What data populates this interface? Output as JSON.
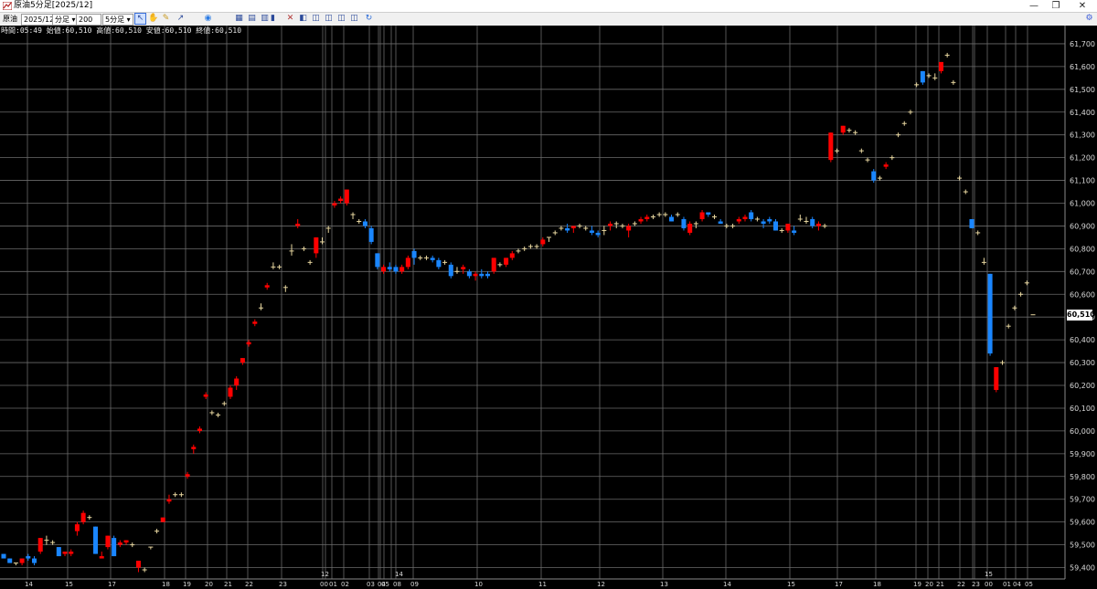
{
  "window": {
    "title": "原油5分足[2025/12]",
    "minimize_glyph": "—",
    "maximize_glyph": "❐",
    "close_glyph": "✕"
  },
  "toolbar": {
    "symbol_label": "原油",
    "contract_value": "2025/12",
    "period_unit_value": "分足",
    "bar_count_value": "200",
    "timeframe_value": "5分足",
    "tool_icons": [
      "cursor-icon",
      "hand-icon",
      "pencil-icon",
      "line-tool-icon",
      "globe-icon",
      "grid-icon",
      "table-icon",
      "grid-alt-icon",
      "bar-chart-icon",
      "candle-icon",
      "indicator-icon",
      "chart-window-icon",
      "chart-window-2-icon",
      "chart-window-3-icon",
      "chart-window-4-icon",
      "refresh-icon",
      "settings-icon"
    ]
  },
  "info_line": "時間:05:49 始値:60,510 高値:60,510 安値:60,510 終値:60,510",
  "colors": {
    "up": "#ff0000",
    "down": "#1a86ff",
    "doji": "#e8d7a0",
    "grid": "#6a6a6a",
    "axis_text": "#d9d9d9",
    "background": "#000000"
  },
  "chart_data": {
    "type": "candlestick",
    "ylim": [
      59350,
      61780
    ],
    "price_ticks": [
      59400,
      59500,
      59600,
      59700,
      59800,
      59900,
      60000,
      60100,
      60200,
      60300,
      60400,
      60500,
      60600,
      60700,
      60800,
      60900,
      61000,
      61100,
      61200,
      61300,
      61400,
      61500,
      61600,
      61700
    ],
    "price_tick_labels": [
      "59,400",
      "59,500",
      "59,600",
      "59,700",
      "59,800",
      "59,900",
      "60,000",
      "60,100",
      "60,200",
      "60,300",
      "60,400",
      "60,500",
      "60,600",
      "60,700",
      "60,800",
      "60,900",
      "61,000",
      "61,100",
      "61,200",
      "61,300",
      "61,400",
      "61,500",
      "61,600",
      "61,700"
    ],
    "last_price_label": "60,510",
    "last_price": 60510,
    "time_labels": [
      "14",
      "15",
      "17",
      "18",
      "19",
      "20",
      "21",
      "22",
      "23",
      "00",
      "01",
      "02",
      "03",
      "04",
      "05",
      "08",
      "09",
      "10",
      "11",
      "12",
      "13",
      "14",
      "15",
      "17",
      "18",
      "19",
      "20",
      "21",
      "22",
      "23",
      "00",
      "01",
      "04",
      "05"
    ],
    "date_labels": [
      "12",
      "14",
      "15"
    ],
    "candles": [
      [
        59460,
        59460,
        59440,
        59440
      ],
      [
        59440,
        59440,
        59420,
        59420
      ],
      [
        59420,
        59420,
        59410,
        59420
      ],
      [
        59420,
        59440,
        59410,
        59440
      ],
      [
        59450,
        59460,
        59430,
        59440
      ],
      [
        59440,
        59450,
        59410,
        59420
      ],
      [
        59470,
        59530,
        59460,
        59530
      ],
      [
        59520,
        59540,
        59500,
        59520
      ],
      [
        59510,
        59520,
        59500,
        59510
      ],
      [
        59490,
        59490,
        59450,
        59450
      ],
      [
        59460,
        59470,
        59450,
        59470
      ],
      [
        59460,
        59480,
        59450,
        59470
      ],
      [
        59560,
        59600,
        59540,
        59590
      ],
      [
        59600,
        59650,
        59590,
        59640
      ],
      [
        59620,
        59630,
        59610,
        59620
      ],
      [
        59580,
        59580,
        59460,
        59460
      ],
      [
        59440,
        59470,
        59440,
        59450
      ],
      [
        59490,
        59540,
        59480,
        59540
      ],
      [
        59530,
        59540,
        59450,
        59450
      ],
      [
        59500,
        59520,
        59490,
        59510
      ],
      [
        59510,
        59520,
        59500,
        59520
      ],
      [
        59500,
        59510,
        59490,
        59500
      ],
      [
        59400,
        59430,
        59380,
        59430
      ],
      [
        59390,
        59400,
        59380,
        59390
      ],
      [
        59490,
        59490,
        59480,
        59490
      ],
      [
        59560,
        59570,
        59550,
        59560
      ],
      [
        59600,
        59620,
        59600,
        59620
      ],
      [
        59690,
        59720,
        59680,
        59700
      ],
      [
        59720,
        59730,
        59710,
        59720
      ],
      [
        59720,
        59730,
        59710,
        59720
      ],
      [
        59800,
        59820,
        59790,
        59810
      ],
      [
        59920,
        59940,
        59900,
        59930
      ],
      [
        60000,
        60020,
        59990,
        60010
      ],
      [
        60150,
        60170,
        60140,
        60160
      ],
      [
        60080,
        60090,
        60070,
        60080
      ],
      [
        60070,
        60080,
        60060,
        60070
      ],
      [
        60120,
        60130,
        60110,
        60120
      ],
      [
        60150,
        60200,
        60140,
        60190
      ],
      [
        60200,
        60240,
        60180,
        60230
      ],
      [
        60300,
        60320,
        60290,
        60320
      ],
      [
        60380,
        60400,
        60370,
        60390
      ],
      [
        60470,
        60490,
        60460,
        60480
      ],
      [
        60540,
        60560,
        60530,
        60540
      ],
      [
        60630,
        60650,
        60620,
        60640
      ],
      [
        60720,
        60740,
        60710,
        60720
      ],
      [
        60720,
        60730,
        60710,
        60720
      ],
      [
        60630,
        60640,
        60610,
        60630
      ],
      [
        60790,
        60820,
        60770,
        60790
      ],
      [
        60900,
        60930,
        60890,
        60910
      ],
      [
        60800,
        60810,
        60790,
        60800
      ],
      [
        60740,
        60750,
        60730,
        60740
      ],
      [
        60780,
        60850,
        60760,
        60850
      ],
      [
        60830,
        60850,
        60820,
        60830
      ],
      [
        60890,
        60900,
        60870,
        60890
      ],
      [
        60990,
        61010,
        60980,
        61000
      ],
      [
        61010,
        61030,
        61000,
        61020
      ],
      [
        61000,
        61060,
        60990,
        61060
      ],
      [
        60950,
        60960,
        60930,
        60950
      ],
      [
        60920,
        60930,
        60910,
        60920
      ],
      [
        60920,
        60930,
        60890,
        60900
      ],
      [
        60890,
        60900,
        60820,
        60830
      ],
      [
        60780,
        60780,
        60710,
        60720
      ],
      [
        60700,
        60730,
        60690,
        60720
      ],
      [
        60720,
        60740,
        60700,
        60710
      ],
      [
        60720,
        60730,
        60690,
        60700
      ],
      [
        60700,
        60730,
        60690,
        60720
      ],
      [
        60720,
        60770,
        60710,
        60760
      ],
      [
        60790,
        60800,
        60730,
        60760
      ],
      [
        60760,
        60770,
        60750,
        60760
      ],
      [
        60760,
        60770,
        60750,
        60760
      ],
      [
        60760,
        60770,
        60740,
        60750
      ],
      [
        60750,
        60760,
        60710,
        60720
      ],
      [
        60740,
        60750,
        60730,
        60740
      ],
      [
        60730,
        60740,
        60670,
        60680
      ],
      [
        60700,
        60720,
        60690,
        60700
      ],
      [
        60710,
        60730,
        60690,
        60720
      ],
      [
        60700,
        60710,
        60670,
        60680
      ],
      [
        60680,
        60700,
        60660,
        60690
      ],
      [
        60690,
        60710,
        60670,
        60680
      ],
      [
        60690,
        60700,
        60670,
        60680
      ],
      [
        60700,
        60760,
        60690,
        60760
      ],
      [
        60730,
        60740,
        60720,
        60730
      ],
      [
        60730,
        60760,
        60720,
        60760
      ],
      [
        60760,
        60790,
        60750,
        60780
      ],
      [
        60790,
        60800,
        60780,
        60790
      ],
      [
        60800,
        60810,
        60790,
        60800
      ],
      [
        60810,
        60820,
        60800,
        60810
      ],
      [
        60810,
        60820,
        60800,
        60810
      ],
      [
        60820,
        60850,
        60810,
        60840
      ],
      [
        60850,
        60850,
        60830,
        60850
      ],
      [
        60870,
        60880,
        60860,
        60870
      ],
      [
        60890,
        60900,
        60880,
        60890
      ],
      [
        60890,
        60910,
        60870,
        60880
      ],
      [
        60890,
        60900,
        60870,
        60900
      ],
      [
        60900,
        60910,
        60890,
        60900
      ],
      [
        60890,
        60900,
        60880,
        60890
      ],
      [
        60880,
        60900,
        60860,
        60870
      ],
      [
        60870,
        60880,
        60850,
        60860
      ],
      [
        60880,
        60900,
        60860,
        60880
      ],
      [
        60900,
        60920,
        60880,
        60910
      ],
      [
        60910,
        60920,
        60890,
        60910
      ],
      [
        60900,
        60910,
        60890,
        60900
      ],
      [
        60880,
        60910,
        60850,
        60900
      ],
      [
        60910,
        60920,
        60900,
        60910
      ],
      [
        60920,
        60940,
        60910,
        60930
      ],
      [
        60930,
        60950,
        60920,
        60940
      ],
      [
        60940,
        60950,
        60930,
        60940
      ],
      [
        60950,
        60960,
        60940,
        60950
      ],
      [
        60950,
        60960,
        60940,
        60950
      ],
      [
        60940,
        60950,
        60920,
        60920
      ],
      [
        60950,
        60960,
        60940,
        60950
      ],
      [
        60930,
        60940,
        60880,
        60890
      ],
      [
        60870,
        60920,
        60860,
        60910
      ],
      [
        60910,
        60920,
        60890,
        60910
      ],
      [
        60930,
        60970,
        60920,
        60960
      ],
      [
        60960,
        60960,
        60940,
        60950
      ],
      [
        60940,
        60950,
        60930,
        60940
      ],
      [
        60920,
        60930,
        60910,
        60910
      ],
      [
        60900,
        60910,
        60890,
        60900
      ],
      [
        60900,
        60910,
        60890,
        60900
      ],
      [
        60920,
        60940,
        60910,
        60930
      ],
      [
        60930,
        60950,
        60920,
        60940
      ],
      [
        60960,
        60970,
        60920,
        60930
      ],
      [
        60930,
        60940,
        60920,
        60930
      ],
      [
        60920,
        60930,
        60890,
        60910
      ],
      [
        60930,
        60940,
        60910,
        60920
      ],
      [
        60920,
        60930,
        60880,
        60880
      ],
      [
        60880,
        60890,
        60870,
        60880
      ],
      [
        60880,
        60910,
        60870,
        60910
      ],
      [
        60880,
        60900,
        60860,
        60870
      ],
      [
        60930,
        60950,
        60920,
        60930
      ],
      [
        60920,
        60940,
        60910,
        60920
      ],
      [
        60930,
        60940,
        60890,
        60900
      ],
      [
        60900,
        60920,
        60880,
        60910
      ],
      [
        60900,
        60910,
        60890,
        60900
      ],
      [
        61190,
        61310,
        61180,
        61310
      ],
      [
        61230,
        61240,
        61220,
        61230
      ],
      [
        61310,
        61340,
        61300,
        61340
      ],
      [
        61320,
        61330,
        61310,
        61320
      ],
      [
        61310,
        61320,
        61300,
        61310
      ],
      [
        61230,
        61240,
        61220,
        61230
      ],
      [
        61190,
        61200,
        61180,
        61190
      ],
      [
        61140,
        61150,
        61090,
        61100
      ],
      [
        61110,
        61120,
        61100,
        61110
      ],
      [
        61160,
        61180,
        61150,
        61170
      ],
      [
        61200,
        61210,
        61190,
        61200
      ],
      [
        61300,
        61310,
        61290,
        61300
      ],
      [
        61350,
        61360,
        61340,
        61350
      ],
      [
        61400,
        61410,
        61390,
        61400
      ],
      [
        61520,
        61530,
        61510,
        61520
      ],
      [
        61580,
        61580,
        61520,
        61530
      ],
      [
        61560,
        61570,
        61550,
        61560
      ],
      [
        61550,
        61570,
        61540,
        61550
      ],
      [
        61580,
        61620,
        61570,
        61620
      ],
      [
        61650,
        61660,
        61640,
        61650
      ],
      [
        61530,
        61540,
        61520,
        61530
      ],
      [
        61110,
        61120,
        61100,
        61110
      ],
      [
        61050,
        61060,
        61040,
        61050
      ],
      [
        60930,
        60930,
        60890,
        60890
      ],
      [
        60870,
        60880,
        60860,
        60870
      ],
      [
        60740,
        60760,
        60730,
        60740
      ],
      [
        60690,
        60690,
        60330,
        60340
      ],
      [
        60180,
        60280,
        60170,
        60280
      ],
      [
        60300,
        60310,
        60290,
        60300
      ],
      [
        60460,
        60470,
        60450,
        60460
      ],
      [
        60540,
        60550,
        60530,
        60540
      ],
      [
        60600,
        60610,
        60590,
        60600
      ],
      [
        60650,
        60660,
        60640,
        60650
      ],
      [
        60510,
        60510,
        60510,
        60510
      ]
    ]
  }
}
